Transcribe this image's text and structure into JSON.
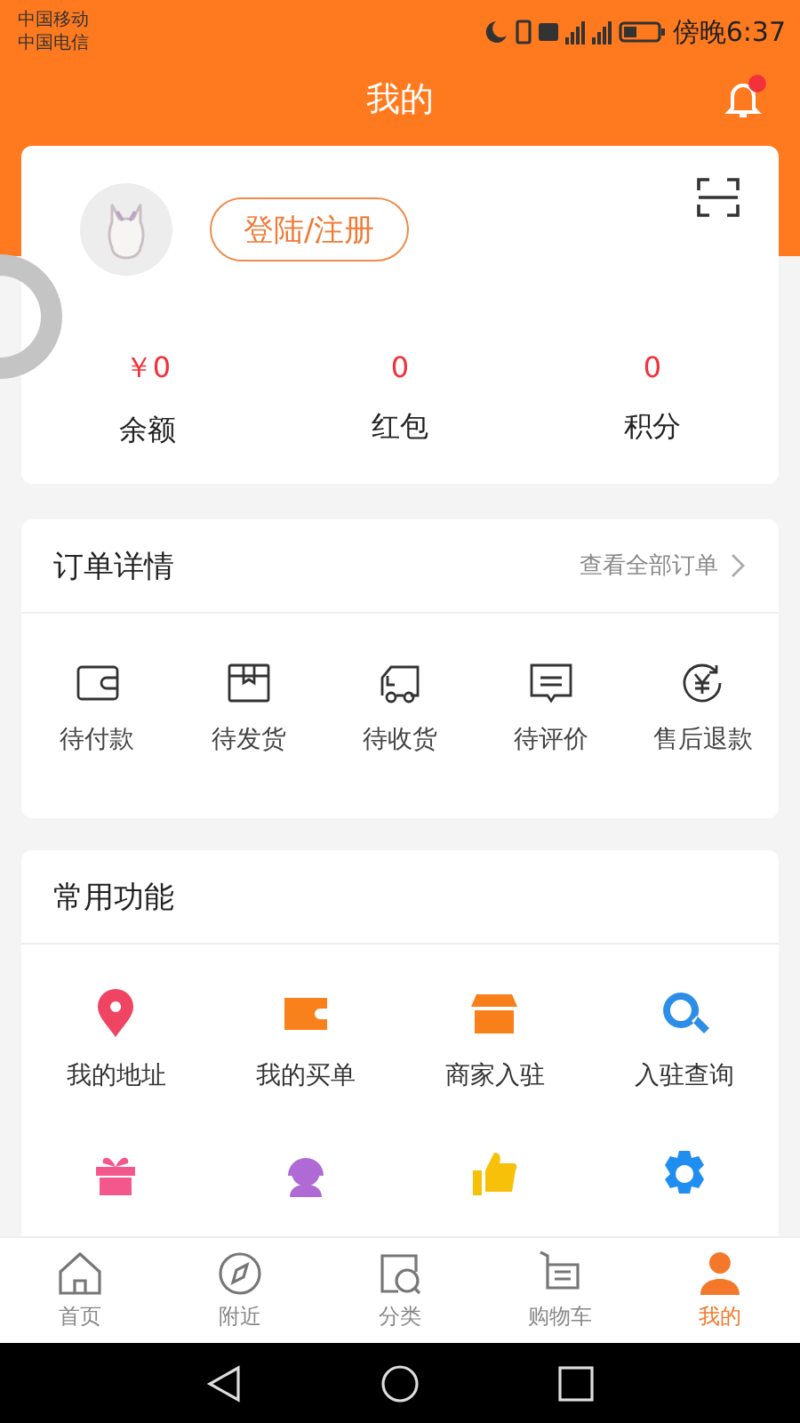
{
  "status_bar": {
    "carriers": [
      "中国移动",
      "中国电信"
    ],
    "time": "傍晚6:37"
  },
  "header": {
    "title": "我的",
    "has_notification": true
  },
  "profile": {
    "login_button": "登陆/注册",
    "stats": [
      {
        "value": "￥0",
        "label": "余额"
      },
      {
        "value": "0",
        "label": "红包"
      },
      {
        "value": "0",
        "label": "积分"
      }
    ]
  },
  "orders": {
    "title": "订单详情",
    "view_all": "查看全部订单",
    "items": [
      "待付款",
      "待发货",
      "待收货",
      "待评价",
      "售后退款"
    ]
  },
  "functions": {
    "title": "常用功能",
    "items": [
      "我的地址",
      "我的买单",
      "商家入驻",
      "入驻查询"
    ]
  },
  "tabs": [
    {
      "label": "首页",
      "selected": false
    },
    {
      "label": "附近",
      "selected": false
    },
    {
      "label": "分类",
      "selected": false
    },
    {
      "label": "购物车",
      "selected": false
    },
    {
      "label": "我的",
      "selected": true
    }
  ]
}
